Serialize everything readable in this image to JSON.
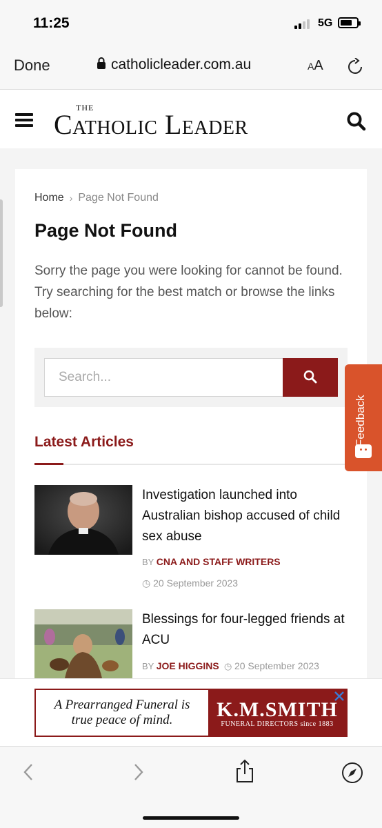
{
  "status_bar": {
    "time": "11:25",
    "network": "5G",
    "signal_bars": 2,
    "signal_total": 4,
    "battery_level": 0.6
  },
  "browser": {
    "done_label": "Done",
    "url": "catholicleader.com.au",
    "text_size_label_small": "A",
    "text_size_label_large": "A"
  },
  "site": {
    "logo_the": "THE",
    "logo_main": "Catholic Leader"
  },
  "breadcrumb": {
    "home": "Home",
    "separator": "›",
    "current": "Page Not Found"
  },
  "page": {
    "title": "Page Not Found",
    "description": "Sorry the page you were looking for cannot be found. Try searching for the best match or browse the links below:"
  },
  "search": {
    "placeholder": "Search..."
  },
  "latest": {
    "title": "Latest Articles",
    "articles": [
      {
        "title": "Investigation launched into Australian bishop accused of child sex abuse",
        "by": "BY",
        "author": "CNA AND STAFF WRITERS",
        "date": "20 September 2023"
      },
      {
        "title": "Blessings for four-legged friends at ACU",
        "by": "BY",
        "author": "JOE HIGGINS",
        "date": "20 September 2023"
      }
    ]
  },
  "feedback": {
    "label": "Feedback"
  },
  "ad": {
    "line1": "A Prearranged Funeral is",
    "line2": "true peace of mind.",
    "brand": "K.M.SMITH",
    "sub": "FUNERAL DIRECTORS since 1883"
  },
  "colors": {
    "brand": "#8b1a1a",
    "feedback": "#d9532b"
  },
  "icons": [
    "lock-icon",
    "reload-icon",
    "menu-icon",
    "search-icon",
    "clock-icon",
    "close-icon",
    "back-icon",
    "forward-icon",
    "share-icon",
    "compass-icon"
  ]
}
